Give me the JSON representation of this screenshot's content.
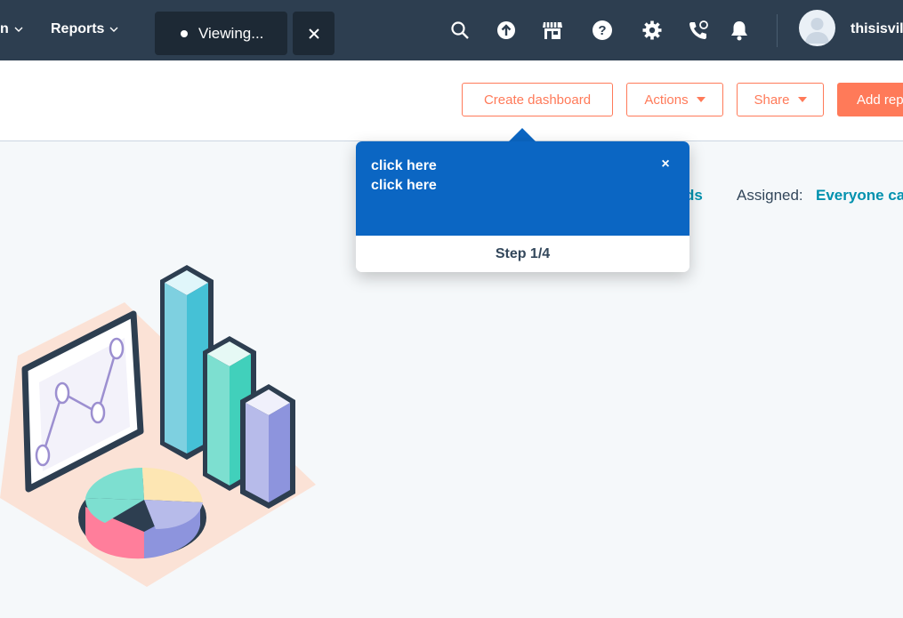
{
  "nav": {
    "partial_item": "n",
    "reports_label": "Reports",
    "viewing_label": "Viewing...",
    "username": "thisisvil"
  },
  "icons": {
    "search": "search-icon",
    "upgrade": "upgrade-arrow-icon",
    "marketplace": "marketplace-store-icon",
    "help": "help-icon",
    "settings": "gear-icon",
    "calling": "phone-calling-icon",
    "notifications": "bell-icon"
  },
  "header": {
    "create_dashboard": "Create dashboard",
    "actions": "Actions",
    "share": "Share",
    "add_report": "Add rep"
  },
  "filters": {
    "partial_text": "ds",
    "assigned_label": "Assigned:",
    "assigned_value": "Everyone ca"
  },
  "tooltip": {
    "line1": "click here",
    "line2": "click here",
    "close": "×",
    "step": "Step 1/4"
  },
  "colors": {
    "nav_bg": "#2d3e50",
    "accent": "#ff7a59",
    "link": "#0091ae",
    "tooltip_bg": "#0b66c3"
  }
}
